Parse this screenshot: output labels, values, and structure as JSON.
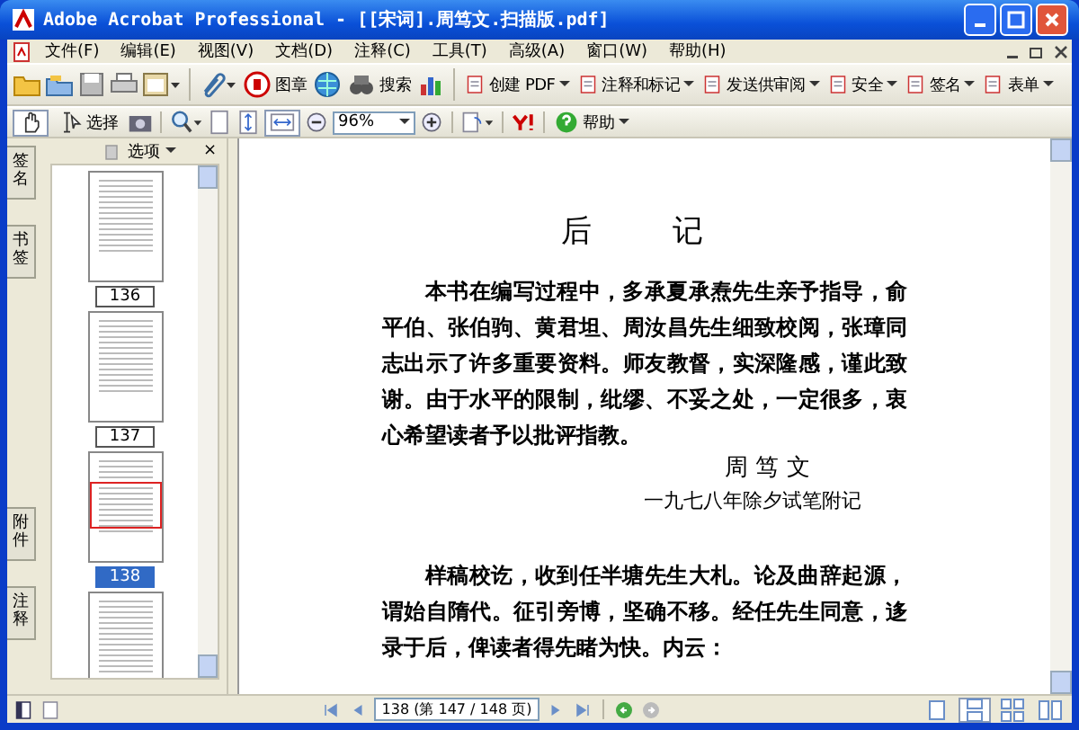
{
  "window": {
    "title": "Adobe Acrobat Professional - [[宋词].周笃文.扫描版.pdf]"
  },
  "menu_bar": [
    "文件(F)",
    "编辑(E)",
    "视图(V)",
    "文档(D)",
    "注释(C)",
    "工具(T)",
    "高级(A)",
    "窗口(W)",
    "帮助(H)"
  ],
  "toolbar_1": {
    "stamp": "图章",
    "search": "搜索",
    "tasks": [
      "创建 PDF",
      "注释和标记",
      "发送供审阅",
      "安全",
      "签名",
      "表单"
    ]
  },
  "toolbar_2": {
    "hand": {
      "selected": true
    },
    "select": {
      "label": "选择",
      "selected": false
    },
    "fit_width": {
      "selected": true
    },
    "zoom": "96%",
    "help": "帮助"
  },
  "side_tabs": [
    {
      "label": "签名",
      "selected": false
    },
    {
      "label": "书签",
      "selected": false
    },
    {
      "label": "附件",
      "selected": false
    },
    {
      "label": "注释",
      "selected": false
    }
  ],
  "pages_panel": {
    "options": "选项",
    "close": "×",
    "thumbnails": [
      {
        "label": "136",
        "selected": false
      },
      {
        "label": "137",
        "selected": false
      },
      {
        "label": "138",
        "selected": true
      },
      {
        "selected": false
      }
    ]
  },
  "document": {
    "title": "后　记",
    "paragraphs": [
      "本书在编写过程中，多承夏承焘先生亲予指导，俞平伯、张伯驹、黄君坦、周汝昌先生细致校阅，张璋同志出示了许多重要资料。师友教督，实深隆感，谨此致谢。由于水平的限制，纰缪、不妥之处，一定很多，衷心希望读者予以批评指教。"
    ],
    "signature": "周 笃 文",
    "date": "一九七八年除夕试笔附记",
    "paragraphs_2": [
      "样稿校讫，收到任半塘先生大札。论及曲辞起源，谓始自隋代。征引旁博，坚确不移。经任先生同意，迻录于后，俾读者得先睹为快。内云："
    ]
  },
  "status_bar": {
    "page": "138 (第 147 / 148 页)",
    "views": [
      {
        "selected": false
      },
      {
        "selected": true
      },
      {
        "selected": false
      },
      {
        "selected": false
      }
    ]
  }
}
